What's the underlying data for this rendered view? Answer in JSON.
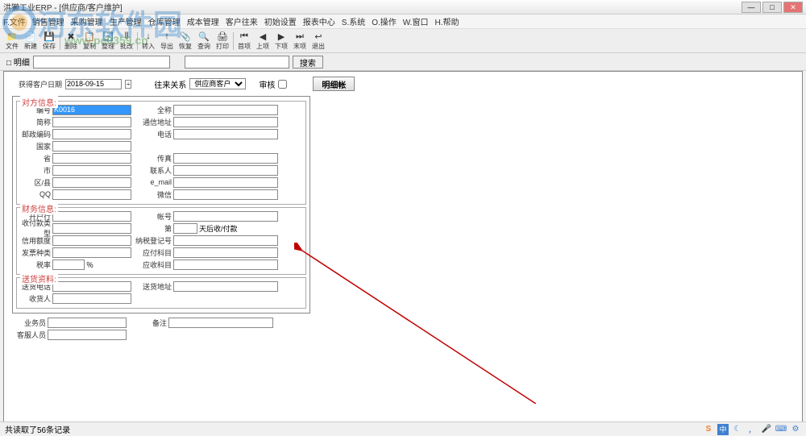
{
  "window": {
    "title": "洪獭工业ERP - [供应商/客户维护]"
  },
  "menu": {
    "items": [
      "F.文件",
      "销售管理",
      "采购管理",
      "生产管理",
      "仓库管理",
      "成本管理",
      "客户往来",
      "初始设置",
      "报表中心",
      "S.系统",
      "O.操作",
      "W.窗口",
      "H.帮助"
    ]
  },
  "toolbar": {
    "buttons": [
      {
        "name": "files-icon",
        "icon": "📁",
        "label": "文件"
      },
      {
        "name": "new-icon",
        "icon": "📄",
        "label": "新建"
      },
      {
        "name": "save-icon",
        "icon": "💾",
        "label": "保存"
      },
      {
        "name": "delete-icon",
        "icon": "✖",
        "label": "删除"
      },
      {
        "name": "copy-icon",
        "icon": "📋",
        "label": "复制"
      },
      {
        "name": "refresh-icon",
        "icon": "🔄",
        "label": "整理"
      },
      {
        "name": "batch-icon",
        "icon": "⫴",
        "label": "批改"
      },
      {
        "name": "import-icon",
        "icon": "↓",
        "label": "转入"
      },
      {
        "name": "export-icon",
        "icon": "↑",
        "label": "导出"
      },
      {
        "name": "paste-icon",
        "icon": "📎",
        "label": "恢复"
      },
      {
        "name": "search-icon",
        "icon": "🔍",
        "label": "查询"
      },
      {
        "name": "print-icon",
        "icon": "🖨",
        "label": "打印"
      },
      {
        "name": "first-icon",
        "icon": "⏮",
        "label": "首项"
      },
      {
        "name": "prev-icon",
        "icon": "◀",
        "label": "上项"
      },
      {
        "name": "next-icon",
        "icon": "▶",
        "label": "下项"
      },
      {
        "name": "last-icon",
        "icon": "⏭",
        "label": "末项"
      },
      {
        "name": "exit-icon",
        "icon": "↩",
        "label": "退出"
      }
    ]
  },
  "searchbar": {
    "details_label": "□ 明细",
    "search_btn": "搜索"
  },
  "toprow": {
    "date_label": "获得客户日期",
    "date_value": "2018-09-15",
    "relation_label": "往来关系",
    "relation_value": "供应商客户",
    "audit_label": "审核",
    "detail_btn": "明细帐"
  },
  "sections": {
    "contact": {
      "title": "对方信息:",
      "bianhao": "编号",
      "bianhao_val": "K0016",
      "quancheng": "全称",
      "jiancheng": "简称",
      "tongxin": "通信地址",
      "youzheng": "邮政编码",
      "dianhua": "电话",
      "guojia": "国家",
      "sheng": "省",
      "chuanzhen": "传真",
      "shi": "市",
      "lianxi": "联系人",
      "quxian": "区/县",
      "email": "e_mail",
      "qq": "QQ",
      "weixin": "微信"
    },
    "finance": {
      "title": "财务信息:",
      "kaihu": "开户行",
      "zhanghao": "帐号",
      "shoufu": "收付款类型",
      "di": "第",
      "tianhou": "天后收/付款",
      "xinyong": "信用额度",
      "nashui": "纳税登记号",
      "fapiao": "发票种类",
      "yingfu": "应付科目",
      "shuilv": "税率",
      "percent": "％",
      "yingshou": "应收科目"
    },
    "delivery": {
      "title": "送货资料:",
      "songhuo_dh": "送货电话",
      "songhuo_dz": "送货地址",
      "shouhuo": "收货人"
    },
    "extra": {
      "yewu": "业务员",
      "beizhu": "备注",
      "kefu": "客服人员"
    }
  },
  "statusbar": {
    "text": "共读取了56条记录"
  },
  "watermark": {
    "main": "河东软件园",
    "sub": "www.pc0359.cn"
  }
}
